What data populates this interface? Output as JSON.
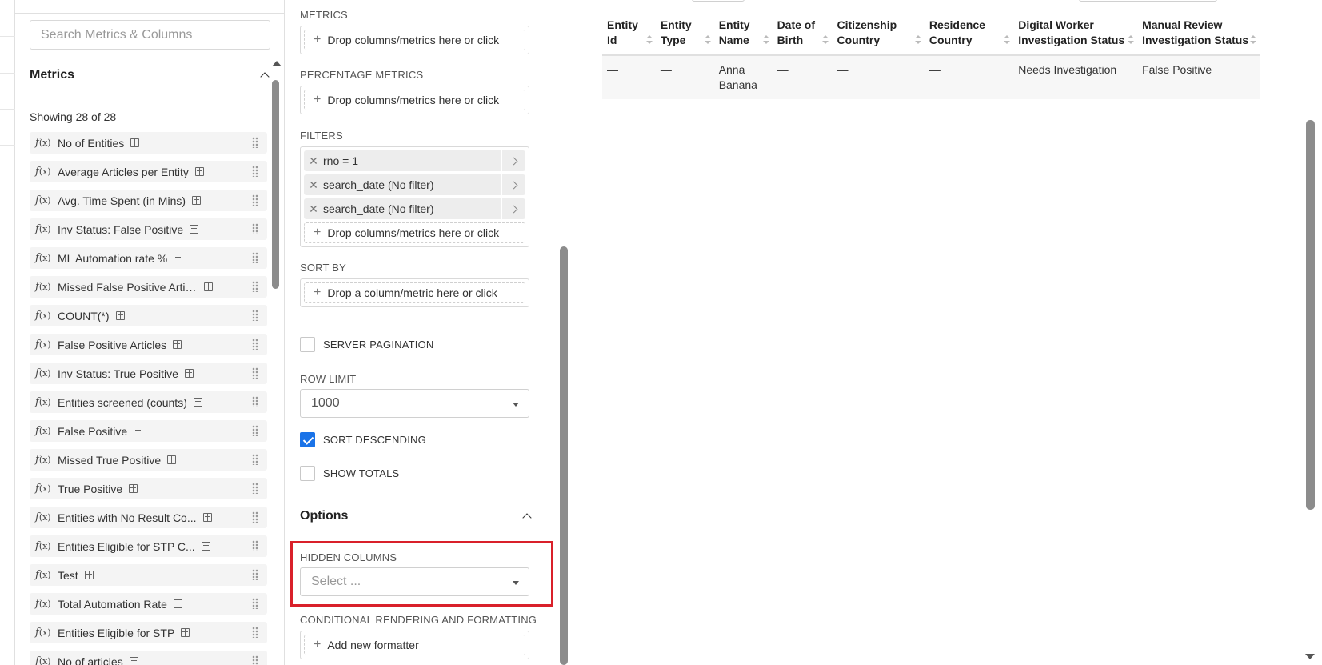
{
  "datasource": {
    "search_placeholder": "Search Metrics & Columns",
    "metrics_title": "Metrics",
    "showing_text": "Showing 28 of 28",
    "fx_symbol": "f",
    "fx_arg": "(x)",
    "metrics": [
      "No of Entities",
      "Average Articles per Entity",
      "Avg. Time Spent (in Mins)",
      "Inv Status: False Positive",
      "ML Automation rate %",
      "Missed False Positive Artic...",
      "COUNT(*)",
      "False Positive Articles",
      "Inv Status: True Positive",
      "Entities screened (counts)",
      "False Positive",
      "Missed True Positive",
      "True Positive",
      "Entities with No Result Co...",
      "Entities Eligible for STP C...",
      "Test",
      "Total Automation Rate",
      "Entities Eligible for STP",
      "No of articles"
    ]
  },
  "controls": {
    "metrics_label": "METRICS",
    "drop_text": "Drop columns/metrics here or click",
    "percentage_metrics_label": "PERCENTAGE METRICS",
    "filters_label": "FILTERS",
    "filters": [
      "rno = 1",
      "search_date (No filter)",
      "search_date (No filter)"
    ],
    "chip_remove": "✕",
    "sort_by_label": "SORT BY",
    "sort_drop_text": "Drop a column/metric here or click",
    "server_pagination_label": "SERVER PAGINATION",
    "row_limit_label": "ROW LIMIT",
    "row_limit_value": "1000",
    "sort_descending_label": "SORT DESCENDING",
    "show_totals_label": "SHOW TOTALS",
    "options_title": "Options",
    "hidden_columns_label": "HIDDEN COLUMNS",
    "hidden_columns_placeholder": "Select ...",
    "conditional_label": "CONDITIONAL RENDERING AND FORMATTING",
    "add_formatter": "Add new formatter",
    "plus": "+"
  },
  "results": {
    "columns": [
      [
        "Entity",
        "Id"
      ],
      [
        "Entity",
        "Type"
      ],
      [
        "Entity",
        "Name"
      ],
      [
        "Date of",
        "Birth"
      ],
      [
        "Citizenship",
        "Country"
      ],
      [
        "Residence",
        "Country"
      ],
      [
        "Digital Worker",
        "Investigation Status"
      ],
      [
        "Manual Review",
        "Investigation Status"
      ]
    ],
    "rows": [
      {
        "entity_id": "—",
        "entity_type": "—",
        "entity_name_1": "Anna",
        "entity_name_2": "Banana",
        "dob": "—",
        "citizenship": "—",
        "residence": "—",
        "dw_status": "Needs Investigation",
        "mr_status": "False Positive"
      }
    ]
  },
  "colors": {
    "accent": "#1a73e8",
    "highlight": "#d9202a"
  }
}
